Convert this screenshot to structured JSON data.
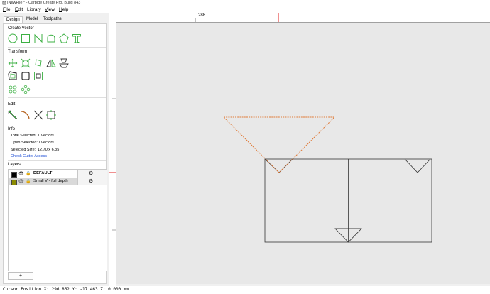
{
  "window": {
    "title": "[NewFile]* - Carbide Create Pro, Build 843"
  },
  "menu": [
    {
      "key": "F",
      "rest": "ile"
    },
    {
      "key": "E",
      "rest": "dit"
    },
    {
      "key": "",
      "rest": "Library"
    },
    {
      "key": "V",
      "rest": "iew"
    },
    {
      "key": "H",
      "rest": "elp"
    }
  ],
  "tabs": [
    "Design",
    "Model",
    "Toolpaths"
  ],
  "sections": {
    "create_vector": "Create Vector",
    "transform": "Transform",
    "edit": "Edit",
    "info": "Info",
    "layers": "Layers"
  },
  "icons": {
    "create_vector": [
      "circle-icon",
      "rectangle-icon",
      "polyline-icon",
      "curve-icon",
      "polygon-icon",
      "text-icon"
    ],
    "transform": [
      "move-icon",
      "resize-icon",
      "rotate-icon",
      "mirror-icon",
      "align-icon",
      "offset-icon",
      "boolean-icon",
      "join-icon",
      "array-icon",
      "radial-array-icon"
    ],
    "edit": [
      "node-edit-icon",
      "fillet-icon",
      "trim-icon",
      "bounds-icon"
    ]
  },
  "info": {
    "rows": [
      {
        "label": "Total Selected:",
        "value": "1 Vectors"
      },
      {
        "label": "Open Selected:",
        "value": "0 Vectors"
      },
      {
        "label": "Selected Size:",
        "value": "12.70 x 6.35"
      }
    ],
    "link": "Check Cutter Access"
  },
  "layers": [
    {
      "name": "DEFAULT",
      "color": "#000000",
      "selected": false
    },
    {
      "name": "Small V - full depth",
      "color": "#8a8a00",
      "selected": true
    }
  ],
  "add_layer_label": "+",
  "ruler": {
    "top_label": "288"
  },
  "status": {
    "cursor": "Cursor Position X: 296.862 Y: -17.463 Z: 0.000 mm"
  },
  "colors": {
    "accent": "#3cb043",
    "selection": "#e07b39",
    "marker": "#e02020",
    "link": "#1a4bd4"
  }
}
